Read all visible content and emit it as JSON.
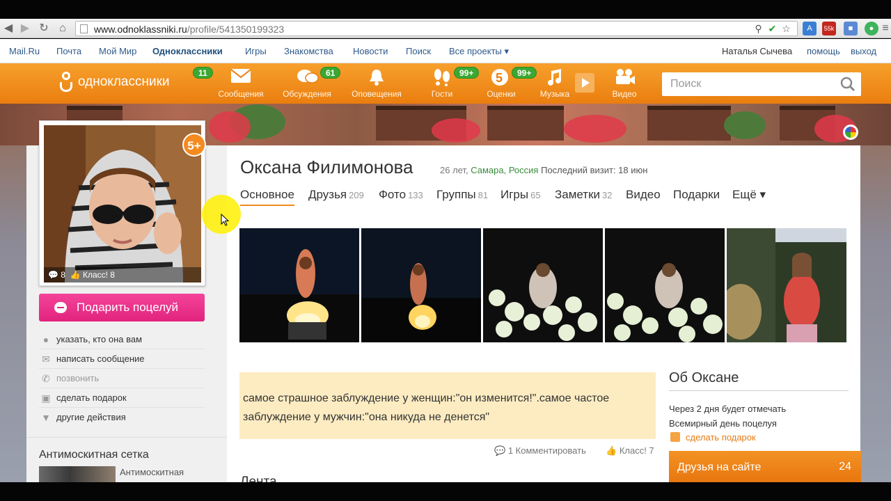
{
  "browser": {
    "url_host": "www.odnoklassniki.ru",
    "url_path": "/profile/541350199323",
    "ext_badge": "55k"
  },
  "topnav": {
    "links": [
      "Mail.Ru",
      "Почта",
      "Мой Мир",
      "Одноклассники",
      "Игры",
      "Знакомства",
      "Новости",
      "Поиск",
      "Все проекты ▾"
    ],
    "user_name": "Наталья Сычева",
    "help": "помощь",
    "logout": "выход"
  },
  "header": {
    "logo_text": "одноклассники",
    "logo_badge": "11",
    "nav": [
      {
        "label": "Сообщения",
        "badge": "",
        "icon": "envelope-icon"
      },
      {
        "label": "Обсуждения",
        "badge": "61",
        "icon": "chat-bubbles-icon"
      },
      {
        "label": "Оповещения",
        "badge": "",
        "icon": "bell-icon"
      },
      {
        "label": "Гости",
        "badge": "99+",
        "icon": "footprints-icon"
      },
      {
        "label": "Оценки",
        "badge": "99+",
        "icon": "rating-five-icon"
      },
      {
        "label": "Музыка",
        "badge": "",
        "icon": "music-note-icon"
      },
      {
        "label": "Видео",
        "badge": "",
        "icon": "video-camera-icon"
      }
    ],
    "search_placeholder": "Поиск"
  },
  "profile": {
    "avatar_comments": "8",
    "avatar_likes": "Класс! 8",
    "rating_badge": "5+",
    "kiss_button": "Подарить поцелуй",
    "actions": [
      {
        "label": "указать, кто она вам",
        "icon": "pin-icon"
      },
      {
        "label": "написать сообщение",
        "icon": "envelope-icon"
      },
      {
        "label": "позвонить",
        "icon": "phone-icon"
      },
      {
        "label": "сделать подарок",
        "icon": "gift-icon"
      },
      {
        "label": "другие действия",
        "icon": "triangle-down-icon"
      }
    ],
    "left_section_title": "Антимоскитная сетка",
    "left_section_caption": "Антимоскитная",
    "name": "Оксана Филимонова",
    "age": "26 лет,",
    "location": "Самара, Россия",
    "last_visit": "Последний визит: 18 июн",
    "tabs": [
      {
        "label": "Основное",
        "count": ""
      },
      {
        "label": "Друзья",
        "count": "209"
      },
      {
        "label": "Фото",
        "count": "133"
      },
      {
        "label": "Группы",
        "count": "81"
      },
      {
        "label": "Игры",
        "count": "65"
      },
      {
        "label": "Заметки",
        "count": "32"
      },
      {
        "label": "Видео",
        "count": ""
      },
      {
        "label": "Подарки",
        "count": ""
      },
      {
        "label": "Ещё ▾",
        "count": ""
      }
    ],
    "status_text": "самое страшное заблуждение у женщин:\"он изменится!\".самое частое заблуждение у мужчин:\"она никуда не денется\"",
    "status_comment": "1 Комментировать",
    "status_like": "Класс! 7",
    "feed_title": "Лента",
    "about_title": "Об Оксане",
    "about_line1": "Через 2 дня будет отмечать",
    "about_line2": "Всемирный день поцелуя",
    "about_gift": "сделать подарок",
    "friends_online_label": "Друзья на сайте",
    "friends_online_count": "24"
  },
  "colors": {
    "orange": "#ea7e0f",
    "badge_green": "#3ca832",
    "kiss_pink": "#e2237e",
    "status_bg": "#fdecc2",
    "link_blue": "#2e5a8a"
  }
}
